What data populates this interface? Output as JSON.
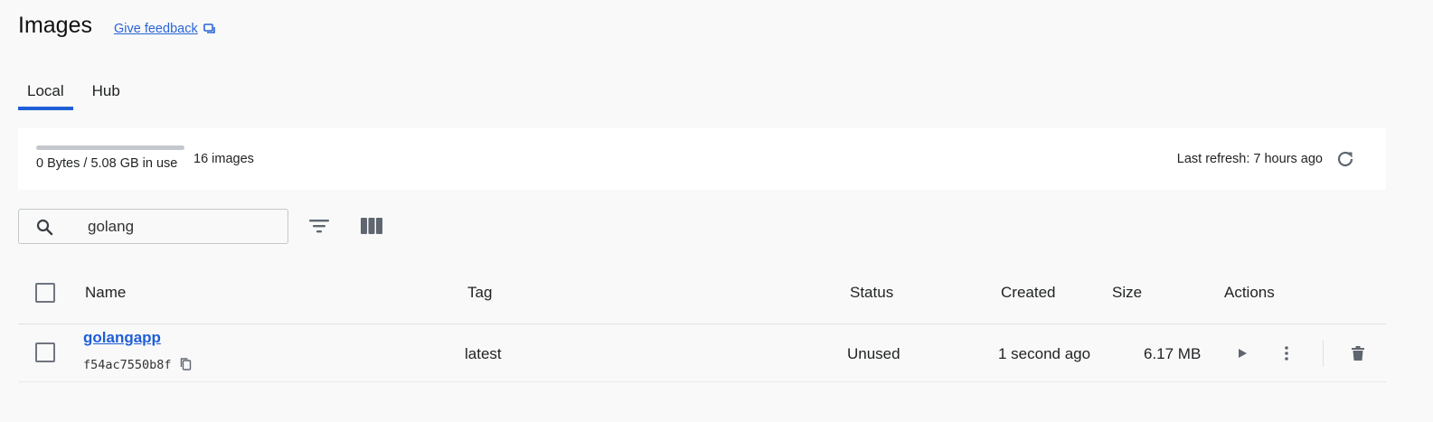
{
  "header": {
    "title": "Images",
    "feedback_label": "Give feedback"
  },
  "tabs": [
    {
      "label": "Local",
      "active": true
    },
    {
      "label": "Hub",
      "active": false
    }
  ],
  "storage": {
    "usage_text": "0 Bytes / 5.08 GB in use",
    "usage_fraction": 0.0,
    "count_text": "16 images",
    "last_refresh": "Last refresh: 7 hours ago"
  },
  "search": {
    "value": "golang",
    "placeholder": "Search"
  },
  "table": {
    "columns": [
      "Name",
      "Tag",
      "Status",
      "Created",
      "Size",
      "Actions"
    ],
    "rows": [
      {
        "name": "golangapp",
        "id": "f54ac7550b8f",
        "tag": "latest",
        "status": "Unused",
        "created": "1 second ago",
        "size": "6.17 MB"
      }
    ]
  },
  "colors": {
    "accent": "#1f5fd6",
    "link": "#2a64d8",
    "background": "#f9f9f9",
    "panel": "#ffffff",
    "icon": "#5f6670"
  },
  "icons": {
    "feedback": "feedback-chat-icon",
    "refresh": "refresh-icon",
    "search": "search-icon",
    "filter": "filter-icon",
    "columns": "view-columns-icon",
    "copy": "copy-icon",
    "run": "play-icon",
    "more": "more-vertical-icon",
    "delete": "trash-icon"
  }
}
